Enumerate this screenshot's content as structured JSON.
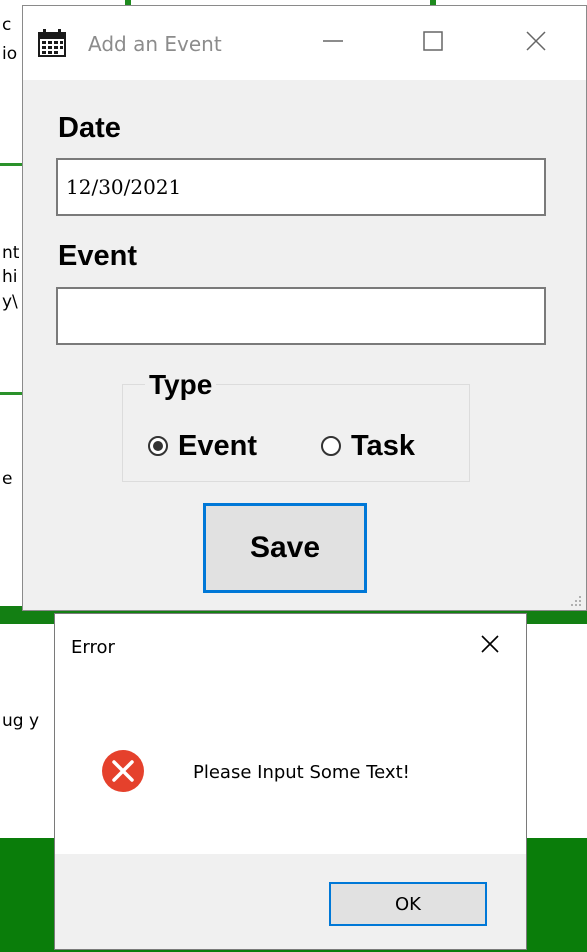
{
  "background_app": {
    "fragments": [
      "c",
      "io",
      "nt",
      "hi",
      "y\\",
      "e",
      "ug y"
    ]
  },
  "event_window": {
    "title": "Add an Event",
    "icon": "calendar-icon",
    "controls": {
      "minimize": "minimize-icon",
      "maximize": "maximize-icon",
      "close": "close-icon"
    },
    "date_label": "Date",
    "date_value": "12/30/2021",
    "event_label": "Event",
    "event_value": "",
    "type_group": {
      "legend": "Type",
      "options": [
        {
          "label": "Event",
          "checked": true
        },
        {
          "label": "Task",
          "checked": false
        }
      ]
    },
    "save_label": "Save"
  },
  "error_dialog": {
    "title": "Error",
    "icon": "error-icon",
    "message": "Please Input Some Text!",
    "ok_label": "OK"
  },
  "colors": {
    "accent": "#0078d7",
    "error_red": "#e5412c",
    "window_bg": "#f0f0f0",
    "background_green": "#0a7d0a"
  }
}
